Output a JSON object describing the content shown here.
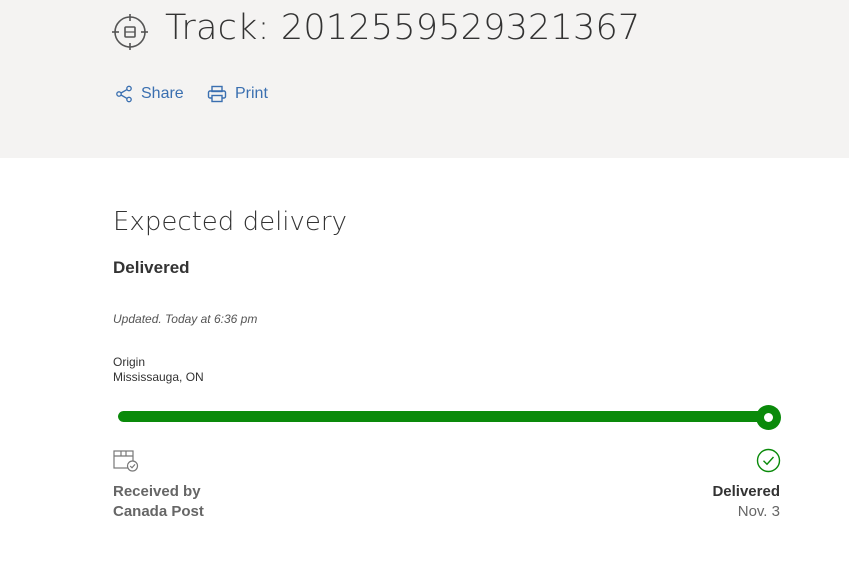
{
  "header": {
    "title": "Track: 2012559529321367",
    "title_icon": "target-icon",
    "actions": [
      {
        "label": "Share",
        "icon": "share-icon"
      },
      {
        "label": "Print",
        "icon": "printer-icon"
      }
    ]
  },
  "delivery": {
    "heading": "Expected delivery",
    "status": "Delivered",
    "updated": "Updated. Today at 6:36 pm",
    "origin_label": "Origin",
    "origin_value": "Mississauga, ON",
    "progress_percent": 100,
    "colors": {
      "progress": "#0a8a0a",
      "link": "#3a6fb0",
      "header_bg": "#f4f3f2"
    },
    "start_step": {
      "line1": "Received by",
      "line2": "Canada Post",
      "icon": "package-check-icon"
    },
    "end_step": {
      "label": "Delivered",
      "date": "Nov. 3",
      "icon": "check-circle-icon"
    }
  }
}
